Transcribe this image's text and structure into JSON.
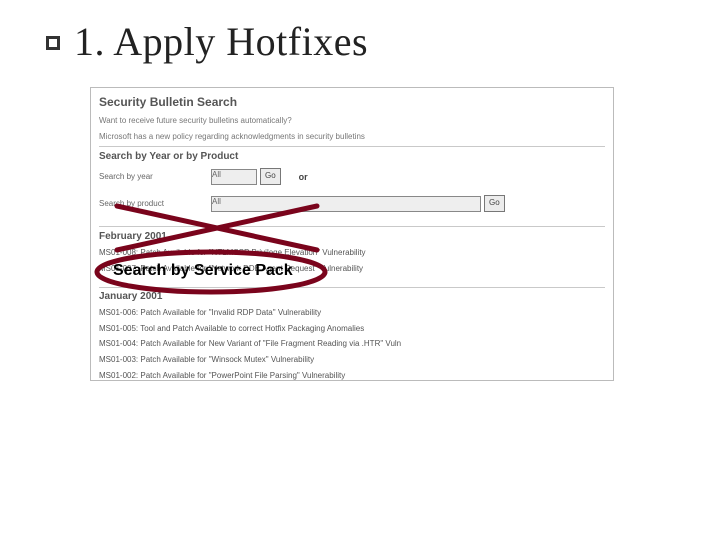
{
  "slide": {
    "title": "1. Apply Hotfixes"
  },
  "panel": {
    "heading": "Security Bulletin Search",
    "link1": "Want to receive future security bulletins automatically?",
    "link2": "Microsoft has a new policy regarding acknowledgments in security bulletins",
    "search_by_hdr": "Search by Year or by Product",
    "year_label": "Search by year",
    "year_select": "All",
    "product_label": "Search by product",
    "product_select": "All",
    "go_label": "Go",
    "or_label": "or"
  },
  "annotation": {
    "label": "Search by Service Pack"
  },
  "groups": [
    {
      "month": "February 2001",
      "entries": [
        "MS01-008: Patch Available for \"NTLMSSP Privilege Elevation\" Vulnerability",
        "MS01-007: Patch Available for \"Network DDE Agent Request\" Vulnerability"
      ]
    },
    {
      "month": "January 2001",
      "entries": [
        "MS01-006: Patch Available for \"Invalid RDP Data\" Vulnerability",
        "MS01-005: Tool and Patch Available to correct Hotfix Packaging Anomalies",
        "MS01-004: Patch Available for New Variant of \"File Fragment Reading via .HTR\" Vuln",
        "MS01-003: Patch Available for \"Winsock Mutex\" Vulnerability",
        "MS01-002: Patch Available for \"PowerPoint File Parsing\" Vulnerability"
      ]
    }
  ]
}
